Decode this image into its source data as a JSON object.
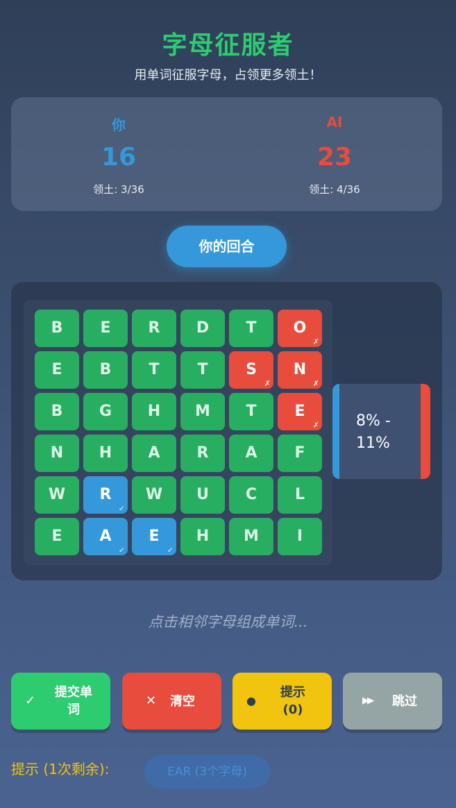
{
  "header": {
    "title": "字母征服者",
    "subtitle": "用单词征服字母，占领更多领土！"
  },
  "players": {
    "you": {
      "name": "你",
      "score": "16",
      "territory": "领土: 3/36",
      "color": "#3498db"
    },
    "ai": {
      "name": "AI",
      "score": "23",
      "territory": "领土: 4/36",
      "color": "#e74c3c"
    }
  },
  "turn": {
    "label": "你的回合"
  },
  "board": {
    "rows": [
      [
        {
          "letter": "B",
          "owner": "neutral"
        },
        {
          "letter": "E",
          "owner": "neutral"
        },
        {
          "letter": "R",
          "owner": "neutral"
        },
        {
          "letter": "D",
          "owner": "neutral"
        },
        {
          "letter": "T",
          "owner": "neutral"
        },
        {
          "letter": "O",
          "owner": "ai"
        }
      ],
      [
        {
          "letter": "E",
          "owner": "neutral"
        },
        {
          "letter": "B",
          "owner": "neutral"
        },
        {
          "letter": "T",
          "owner": "neutral"
        },
        {
          "letter": "T",
          "owner": "neutral"
        },
        {
          "letter": "S",
          "owner": "ai"
        },
        {
          "letter": "N",
          "owner": "ai"
        }
      ],
      [
        {
          "letter": "B",
          "owner": "neutral"
        },
        {
          "letter": "G",
          "owner": "neutral"
        },
        {
          "letter": "H",
          "owner": "neutral"
        },
        {
          "letter": "M",
          "owner": "neutral"
        },
        {
          "letter": "T",
          "owner": "neutral"
        },
        {
          "letter": "E",
          "owner": "ai"
        }
      ],
      [
        {
          "letter": "N",
          "owner": "neutral"
        },
        {
          "letter": "H",
          "owner": "neutral"
        },
        {
          "letter": "A",
          "owner": "neutral"
        },
        {
          "letter": "R",
          "owner": "neutral"
        },
        {
          "letter": "A",
          "owner": "neutral"
        },
        {
          "letter": "F",
          "owner": "neutral"
        }
      ],
      [
        {
          "letter": "W",
          "owner": "neutral"
        },
        {
          "letter": "R",
          "owner": "you"
        },
        {
          "letter": "W",
          "owner": "neutral"
        },
        {
          "letter": "U",
          "owner": "neutral"
        },
        {
          "letter": "C",
          "owner": "neutral"
        },
        {
          "letter": "L",
          "owner": "neutral"
        }
      ],
      [
        {
          "letter": "E",
          "owner": "neutral"
        },
        {
          "letter": "A",
          "owner": "you"
        },
        {
          "letter": "E",
          "owner": "you"
        },
        {
          "letter": "H",
          "owner": "neutral"
        },
        {
          "letter": "M",
          "owner": "neutral"
        },
        {
          "letter": "I",
          "owner": "neutral"
        }
      ]
    ],
    "you_mark": "✓",
    "ai_mark": "✗",
    "colors": {
      "neutral": "#27ae60",
      "you": "#3498db",
      "ai": "#e74c3c"
    }
  },
  "meter": {
    "label": "8% - 11%"
  },
  "instruction": "点击相邻字母组成单词...",
  "buttons": {
    "submit": {
      "icon": "check-icon",
      "glyph": "✓",
      "label": "提交单词"
    },
    "clear": {
      "icon": "close-icon",
      "glyph": "✕",
      "label": "清空"
    },
    "hint": {
      "icon": "lightbulb-icon",
      "glyph": "●",
      "label": "提示 (0)"
    },
    "skip": {
      "icon": "fast-forward-icon",
      "glyph": "▶▶",
      "label": "跳过"
    }
  },
  "hint_bar": {
    "label": "提示 (1次剩余):",
    "suggestion": "EAR (3个字母)"
  }
}
